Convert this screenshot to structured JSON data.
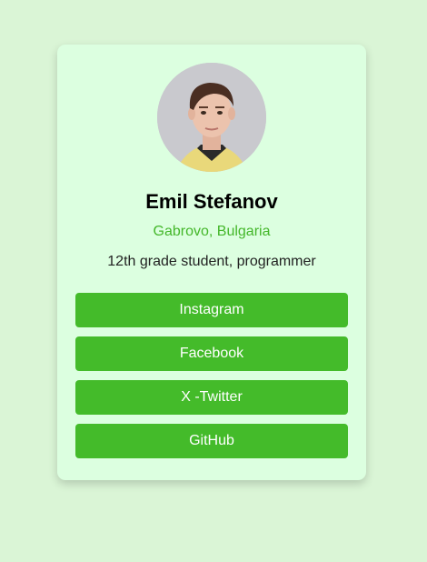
{
  "profile": {
    "name": "Emil Stefanov",
    "location": "Gabrovo, Bulgaria",
    "bio": "12th grade student, programmer"
  },
  "links": [
    {
      "label": "Instagram"
    },
    {
      "label": "Facebook"
    },
    {
      "label": "X -Twitter"
    },
    {
      "label": "GitHub"
    }
  ],
  "colors": {
    "background": "#daf5d6",
    "card": "#dcffe0",
    "accent": "#44bb2a",
    "location_text": "#44b72a"
  }
}
